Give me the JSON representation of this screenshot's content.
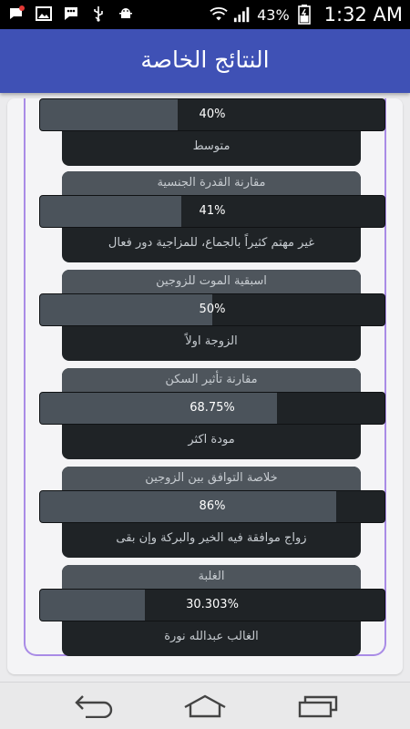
{
  "status_bar": {
    "battery": "43%",
    "time": "1:32 AM"
  },
  "app_bar": {
    "title": "النتائج الخاصة"
  },
  "results": [
    {
      "title": "",
      "percent_label": "40%",
      "percent": 40,
      "caption": "متوسط"
    },
    {
      "title": "مقارنة القدرة الجنسية",
      "percent_label": "41%",
      "percent": 41,
      "caption": "غير مهتم كثيراً بالجماع، للمزاجية دور فعال"
    },
    {
      "title": "اسبقية الموت للزوجين",
      "percent_label": "50%",
      "percent": 50,
      "caption": "الزوجة اولاً"
    },
    {
      "title": "مقارنة تأثير السكن",
      "percent_label": "68.75%",
      "percent": 68.75,
      "caption": "مودة اكثر"
    },
    {
      "title": "خلاصة التوافق بين الزوجين",
      "percent_label": "86%",
      "percent": 86,
      "caption": "زواج موافقة فيه الخير والبركة وإن بقى"
    },
    {
      "title": "الغلبة",
      "percent_label": "30.303%",
      "percent": 30.303,
      "caption": "الغالب عبدالله نورة"
    }
  ],
  "nav": {
    "back_icon": "back-arrow",
    "home_icon": "home",
    "recents_icon": "recent-apps"
  }
}
